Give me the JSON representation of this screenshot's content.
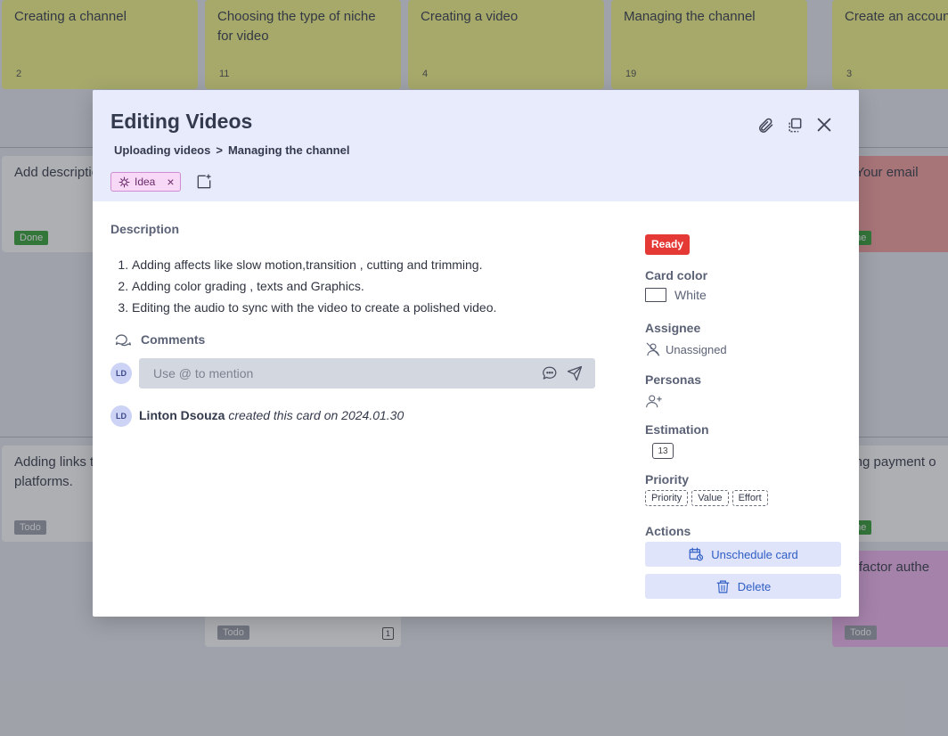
{
  "board": {
    "top_cards": [
      {
        "title": "Creating a channel",
        "count": "2"
      },
      {
        "title": "Choosing the type of niche for video",
        "count": "11"
      },
      {
        "title": "Creating a video",
        "count": "4"
      },
      {
        "title": "Managing the channel",
        "count": "19"
      },
      {
        "title": "Create an account",
        "count": "3"
      }
    ],
    "row2": [
      {
        "title": "Add description details",
        "status": "Done"
      },
      {
        "title": "d Your email",
        "status": "one"
      }
    ],
    "row3": [
      {
        "title": "Adding links t twitter and ot platforms.",
        "status": "Todo"
      },
      {
        "title": "ding payment o",
        "status": "one"
      },
      {
        "title": "lti-factor authe",
        "status": "Todo"
      }
    ],
    "bottom_mid": {
      "status": "Todo",
      "count": "1"
    }
  },
  "modal": {
    "title": "Editing Videos",
    "breadcrumb": {
      "parent": "Uploading videos",
      "separator": ">",
      "current": "Managing the channel"
    },
    "tag": {
      "label": "Idea"
    },
    "description": {
      "label": "Description",
      "items": [
        "Adding affects like slow motion,transition , cutting and trimming.",
        "Adding color grading , texts and Graphics.",
        "Editing the audio to sync with the video to create a polished video."
      ]
    },
    "comments": {
      "label": "Comments",
      "placeholder": "Use @ to mention",
      "avatar_initials": "LD"
    },
    "activity": {
      "avatar_initials": "LD",
      "user": "Linton Dsouza",
      "action": "created this card on 2024.01.30"
    },
    "sidebar": {
      "status": "Ready",
      "status_color": "#e53935",
      "card_color_label": "Card color",
      "card_color_value": "White",
      "assignee_label": "Assignee",
      "assignee_value": "Unassigned",
      "personas_label": "Personas",
      "estimation_label": "Estimation",
      "estimation_value": "13",
      "priority_label": "Priority",
      "priority_chips": [
        "Priority",
        "Value",
        "Effort"
      ],
      "actions_label": "Actions",
      "unschedule_label": "Unschedule card",
      "delete_label": "Delete"
    }
  }
}
